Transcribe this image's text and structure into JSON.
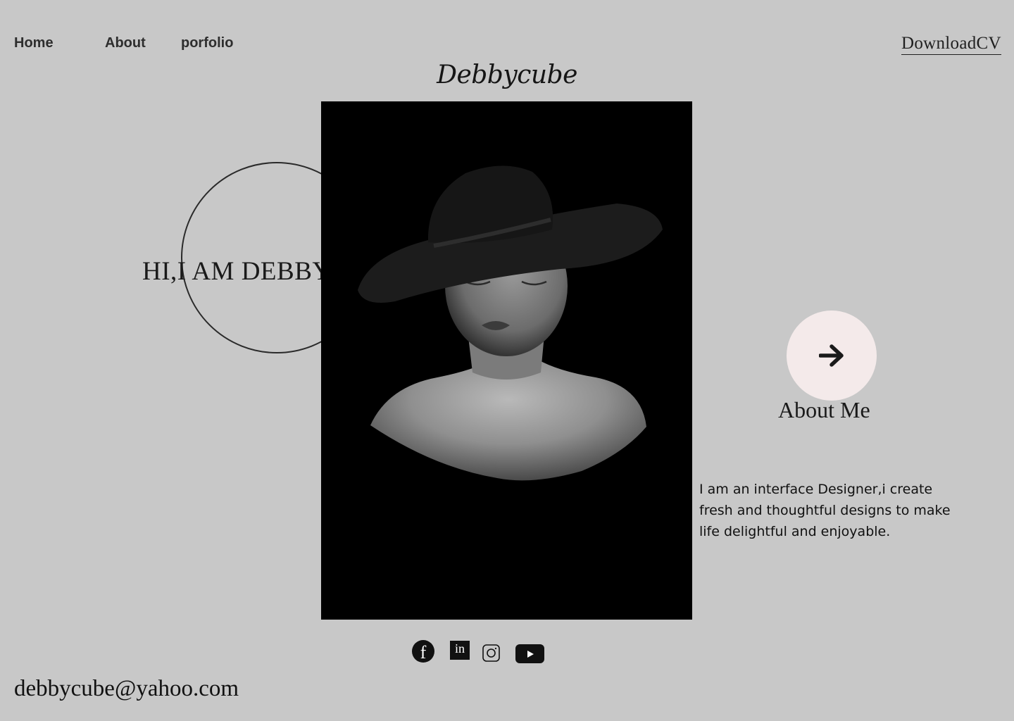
{
  "nav": {
    "home": "Home",
    "about": "About",
    "portfolio": "porfolio",
    "download_cv": "DownloadCV"
  },
  "brand": {
    "logo": "Debbycube"
  },
  "hero": {
    "greeting": "HI,I AM DEBBYCU"
  },
  "about": {
    "title": "About Me",
    "bio": "I am an interface Designer,i create fresh and thoughtful designs to make life delightful and enjoyable."
  },
  "social": {
    "facebook_glyph": "f",
    "linkedin_glyph": "in",
    "icons": [
      "facebook-icon",
      "linkedin-icon",
      "instagram-icon",
      "youtube-icon"
    ]
  },
  "contact": {
    "email": "debbycube@yahoo.com"
  },
  "colors": {
    "background": "#c8c8c8",
    "text": "#1a1a1a",
    "button_bg": "#f4eaea",
    "portrait_bg": "#000000"
  }
}
